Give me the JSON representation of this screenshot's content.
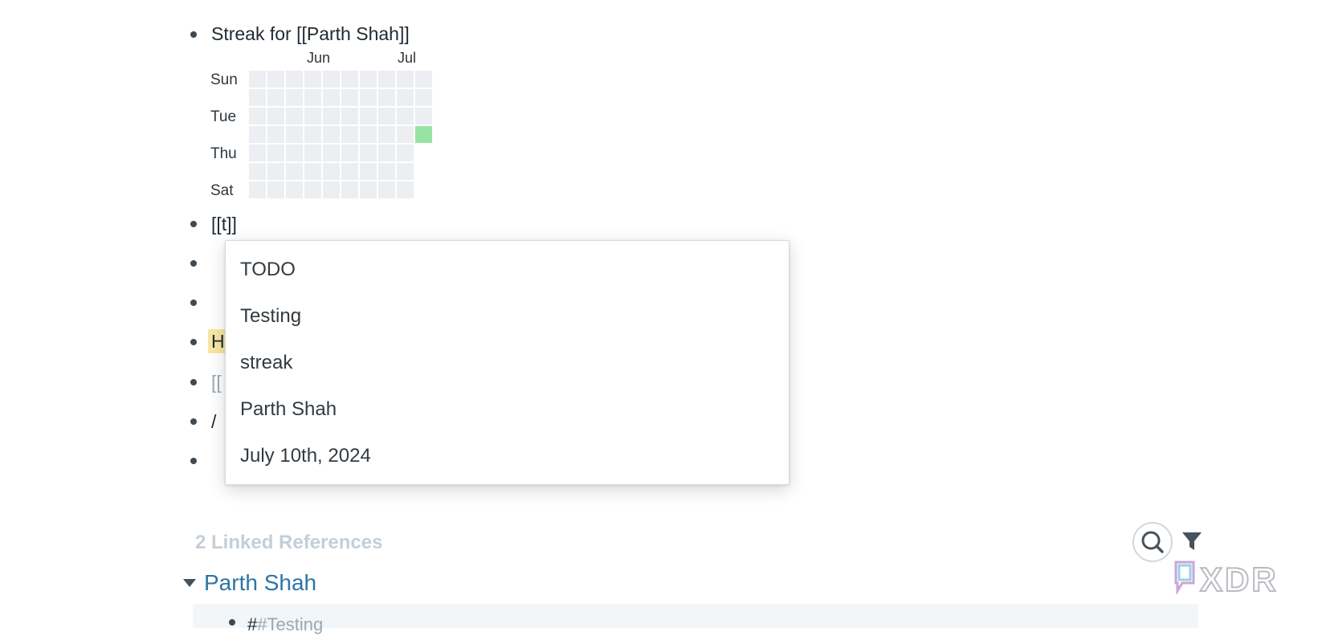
{
  "blocks": {
    "streak_title": "Streak for [[Parth Shah]]",
    "t_link": "[[t]]",
    "highlight_partial": "H",
    "link_partial": "[[",
    "slash": "/"
  },
  "heatmap": {
    "months": [
      "Jun",
      "Jul"
    ],
    "day_labels": [
      "Sun",
      "Tue",
      "Thu",
      "Sat"
    ],
    "weeks": 10,
    "active_color": "#97e3a4",
    "empty_color": "#eceef1",
    "active_cell": {
      "week": 10,
      "weekday": 3
    }
  },
  "autocomplete": {
    "items": [
      "TODO",
      "Testing",
      "streak",
      "Parth Shah",
      "July 10th, 2024"
    ]
  },
  "references": {
    "title": "2 Linked References",
    "group": "Parth Shah",
    "first_item_prefix": "#",
    "first_item_tag": "#Testing"
  },
  "icons": {
    "search": "search-icon",
    "filter": "filter-icon",
    "caret": "caret-down-icon"
  },
  "watermark": "XDR"
}
